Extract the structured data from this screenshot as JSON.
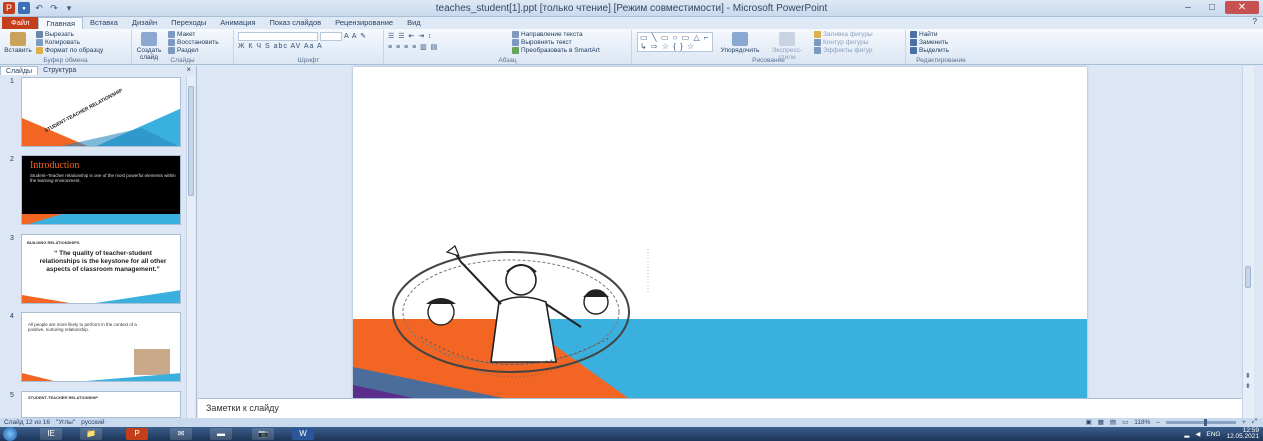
{
  "window": {
    "title": "teaches_student[1].ppt [только чтение] [Режим совместимости] - Microsoft PowerPoint",
    "controls": [
      "–",
      "□",
      "✕"
    ]
  },
  "ribbon_tabs": {
    "file": "Файл",
    "items": [
      "Главная",
      "Вставка",
      "Дизайн",
      "Переходы",
      "Анимация",
      "Показ слайдов",
      "Рецензирование",
      "Вид"
    ],
    "help": "?"
  },
  "ribbon": {
    "clipboard": {
      "paste": "Вставить",
      "cut": "Вырезать",
      "copy": "Копировать",
      "format_painter": "Формат по образцу",
      "label": "Буфер обмена"
    },
    "slides": {
      "new_slide": "Создать слайд",
      "layout": "Макет",
      "reset": "Восстановить",
      "section": "Раздел",
      "label": "Слайды"
    },
    "font": {
      "label": "Шрифт"
    },
    "paragraph": {
      "text_direction": "Направление текста",
      "align_text": "Выровнять текст",
      "smartart": "Преобразовать в SmartArt",
      "label": "Абзац"
    },
    "drawing": {
      "arrange": "Упорядочить",
      "quick_styles": "Экспресс-стили",
      "shape_fill": "Заливка фигуры",
      "shape_outline": "Контур фигуры",
      "shape_effects": "Эффекты фигур",
      "label": "Рисование"
    },
    "editing": {
      "find": "Найти",
      "replace": "Заменить",
      "select": "Выделить",
      "label": "Редактирование"
    }
  },
  "left_panel": {
    "tabs": [
      "Слайды",
      "Структура"
    ],
    "close": "×",
    "thumbnails": [
      {
        "num": "1",
        "text": "STUDENT-TEACHER RELATIONSHIP"
      },
      {
        "num": "2",
        "title": "Introduction",
        "text": "Student–Teacher relationship is one of the most powerful elements within the learning environment."
      },
      {
        "num": "3",
        "heading": "BUILDING RELATIONSHIPS",
        "quote": "“ The quality of teacher-student relationships is the keystone for all other aspects of classroom management.”"
      },
      {
        "num": "4",
        "text": "All people are more likely to perform in the context of a positive, nurturing relationship."
      },
      {
        "num": "5",
        "text": "STUDENT-TEACHER RELATIONSHIP"
      }
    ]
  },
  "notes": {
    "placeholder": "Заметки к слайду"
  },
  "status_bar": {
    "slide_info": "Слайд 12 из 16",
    "theme": "\"Углы\"",
    "language": "русский",
    "zoom": "118%"
  },
  "taskbar": {
    "apps": [
      "IE",
      "📁",
      "P",
      "✉",
      "▬",
      "📷",
      "W"
    ],
    "tray": {
      "lang": "ENG",
      "time": "12:59",
      "date": "12.05.2021"
    }
  },
  "colors": {
    "accent_orange": "#f26522",
    "accent_blue": "#3ab0df",
    "title_bar": "#c9d9ee",
    "file_tab": "#c43e1c"
  }
}
